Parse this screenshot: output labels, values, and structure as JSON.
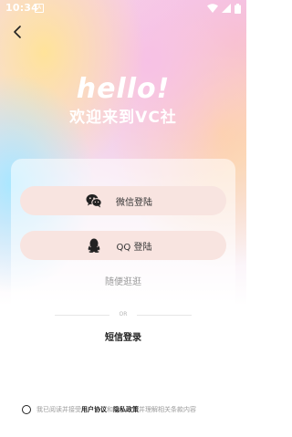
{
  "status_bar": {
    "time": "10:34",
    "notification_icon_letter": "A"
  },
  "header": {
    "back_icon": "chevron-left-icon"
  },
  "hero": {
    "greeting": "hello!",
    "welcome": "欢迎来到VC社"
  },
  "login": {
    "wechat_label": "微信登陆",
    "qq_label": "QQ 登陆",
    "browse_label": "随便逛逛",
    "divider_text": "OR",
    "sms_label": "短信登录"
  },
  "agreement": {
    "prefix": "我已阅读并接受",
    "user_agreement": "用户协议",
    "and": "和",
    "privacy_policy": "隐私政策",
    "suffix": "并理解相关条款内容"
  },
  "colors": {
    "button_bg": "#f8e4e0",
    "hero_text": "#ffffff"
  }
}
